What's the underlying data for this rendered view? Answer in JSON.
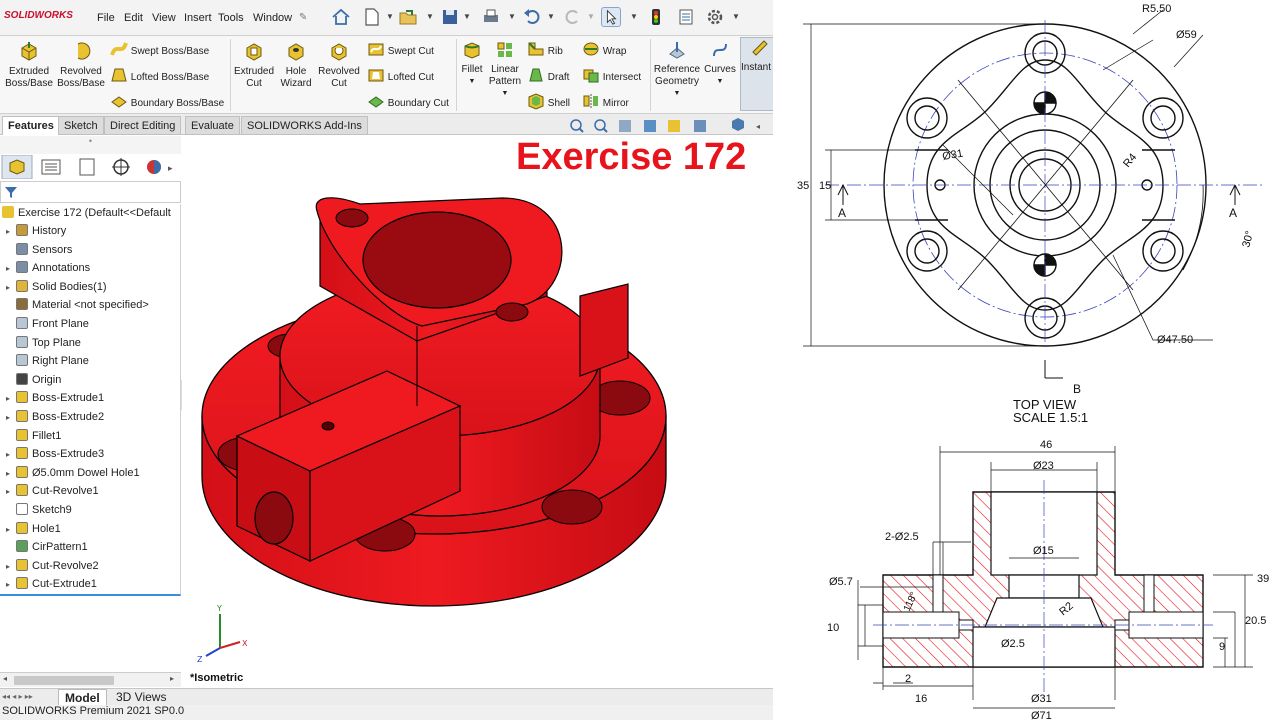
{
  "menubar": {
    "logo": "SOLIDWORKS",
    "menus": [
      "File",
      "Edit",
      "View",
      "Insert",
      "Tools",
      "Window"
    ]
  },
  "features": {
    "extruded_boss": "Extruded\nBoss/Base",
    "revolved_boss": "Revolved\nBoss/Base",
    "swept_boss": "Swept Boss/Base",
    "lofted_boss": "Lofted Boss/Base",
    "boundary_boss": "Boundary Boss/Base",
    "extruded_cut": "Extruded\nCut",
    "hole_wizard": "Hole\nWizard",
    "revolved_cut": "Revolved\nCut",
    "swept_cut": "Swept Cut",
    "lofted_cut": "Lofted Cut",
    "boundary_cut": "Boundary Cut",
    "fillet": "Fillet",
    "linear_pattern": "Linear\nPattern",
    "rib": "Rib",
    "draft": "Draft",
    "shell": "Shell",
    "wrap": "Wrap",
    "intersect": "Intersect",
    "mirror": "Mirror",
    "reference_geometry": "Reference\nGeometry",
    "curves": "Curves",
    "instant3d": "Instant"
  },
  "tabs": [
    "Features",
    "Sketch",
    "Direct Editing",
    "Evaluate",
    "SOLIDWORKS Add-Ins"
  ],
  "tree": {
    "root": "Exercise 172  (Default<<Default",
    "items": [
      {
        "label": "History",
        "arrow": "▸",
        "color": "#c59a3a"
      },
      {
        "label": "Sensors",
        "arrow": "",
        "color": "#7a8fa6"
      },
      {
        "label": "Annotations",
        "arrow": "▸",
        "color": "#7a8fa6"
      },
      {
        "label": "Solid Bodies(1)",
        "arrow": "▸",
        "color": "#e0b43a"
      },
      {
        "label": "Material <not specified>",
        "arrow": "",
        "color": "#8a6d3b"
      },
      {
        "label": "Front Plane",
        "arrow": "",
        "color": "#b9c6d6"
      },
      {
        "label": "Top Plane",
        "arrow": "",
        "color": "#b9c6d6"
      },
      {
        "label": "Right Plane",
        "arrow": "",
        "color": "#b9c6d6"
      },
      {
        "label": "Origin",
        "arrow": "",
        "color": "#444444"
      },
      {
        "label": "Boss-Extrude1",
        "arrow": "▸",
        "color": "#e8c230"
      },
      {
        "label": "Boss-Extrude2",
        "arrow": "▸",
        "color": "#e8c230"
      },
      {
        "label": "Fillet1",
        "arrow": "",
        "color": "#e8c230"
      },
      {
        "label": "Boss-Extrude3",
        "arrow": "▸",
        "color": "#e8c230"
      },
      {
        "label": "Ø5.0mm Dowel Hole1",
        "arrow": "▸",
        "color": "#e8c230"
      },
      {
        "label": "Cut-Revolve1",
        "arrow": "▸",
        "color": "#e8c230"
      },
      {
        "label": "Sketch9",
        "arrow": "",
        "color": "#ffffff"
      },
      {
        "label": "Hole1",
        "arrow": "▸",
        "color": "#e8c230"
      },
      {
        "label": "CirPattern1",
        "arrow": "",
        "color": "#5aa05a"
      },
      {
        "label": "Cut-Revolve2",
        "arrow": "▸",
        "color": "#e8c230"
      },
      {
        "label": "Cut-Extrude1",
        "arrow": "▸",
        "color": "#e8c230"
      }
    ]
  },
  "viewport": {
    "title": "Exercise 172",
    "view_label": "*Isometric",
    "model_color": "#e8141c"
  },
  "bottom_tabs": [
    "Model",
    "3D Views"
  ],
  "status": "SOLIDWORKS Premium 2021 SP0.0",
  "drawing": {
    "top_view_label": "TOP VIEW",
    "top_view_scale": "SCALE 1.5:1",
    "dims_top": {
      "r550": "R5.50",
      "d59": "Ø59",
      "d31": "Ø31",
      "r4": "R4",
      "d4750": "Ø47.50",
      "h35": "35",
      "h15": "15",
      "angle": "30°",
      "sectionA_left": "A",
      "sectionA_right": "A",
      "sectionB": "B"
    },
    "dims_section": {
      "w46": "46",
      "d23": "Ø23",
      "holes": "2-Ø2.5",
      "d15": "Ø15",
      "d57": "Ø5.7",
      "a118": "118°",
      "r2": "R2",
      "h10": "10",
      "d25": "Ø2.5",
      "h39": "39",
      "h205": "20.5",
      "h9": "9",
      "w2": "2",
      "w16": "16",
      "d31b": "Ø31",
      "d71": "Ø71"
    }
  }
}
